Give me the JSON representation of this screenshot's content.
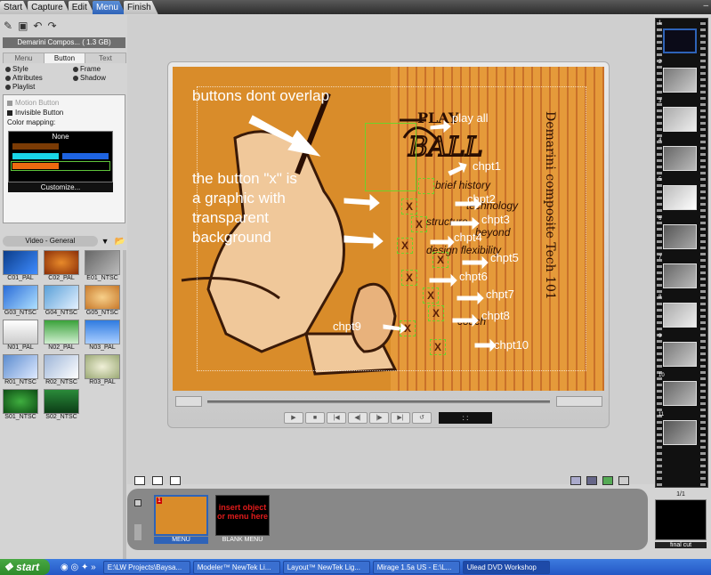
{
  "top_tabs": [
    {
      "label": "Start"
    },
    {
      "label": "Capture"
    },
    {
      "label": "Edit"
    },
    {
      "label": "Menu",
      "active": true
    },
    {
      "label": "Finish"
    }
  ],
  "window_close": "–",
  "project": {
    "name": "Demarini Compos... ( 1.3 GB)"
  },
  "sub_tabs": [
    {
      "label": "Menu"
    },
    {
      "label": "Button",
      "active": true
    },
    {
      "label": "Text"
    }
  ],
  "options": {
    "style": "Style",
    "frame": "Frame",
    "attributes": "Attributes",
    "shadow": "Shadow",
    "playlist": "Playlist"
  },
  "button_panel": {
    "motion_button": "Motion Button",
    "invisible_button": "Invisible Button",
    "color_mapping": "Color mapping:",
    "none": "None",
    "customize": "Customize..."
  },
  "library": {
    "selected": "Video - General",
    "items": [
      "C01_PAL",
      "C02_PAL",
      "E01_NTSC",
      "G03_NTSC",
      "G04_NTSC",
      "G05_NTSC",
      "N01_PAL",
      "N02_PAL",
      "N03_PAL",
      "R01_NTSC",
      "R02_NTSC",
      "R03_PAL",
      "S01_NTSC",
      "S02_NTSC"
    ]
  },
  "menu_preview": {
    "notes": {
      "overlap": "buttons dont overlap",
      "graphic": "the button \"x\" is\na graphic with\ntransparent\nbackground"
    },
    "play_all": "play all",
    "chapters": [
      "chpt1",
      "chpt2",
      "chpt3",
      "chpt4",
      "chpt5",
      "chpt6",
      "chpt7",
      "chpt8",
      "chpt9",
      "chpt10"
    ],
    "x_glyph": "X"
  },
  "transport": {
    "timecode": ": :"
  },
  "filmstrip": {
    "frames": [
      "1",
      "2",
      "3",
      "4",
      "5",
      "6",
      "7",
      "8",
      "9",
      "10",
      "11"
    ]
  },
  "tray": {
    "menu_label": "MENU",
    "blank_label": "BLANK MENU",
    "insert_text": "insert object or menu here"
  },
  "final_cut": {
    "count": "1/1",
    "label": "final cut"
  },
  "taskbar": {
    "start": "start",
    "items": [
      "E:\\LW Projects\\Baysa...",
      "Modeler™ NewTek Li...",
      "Layout™ NewTek Lig...",
      "Mirage 1.5a US - E:\\L...",
      "Ulead DVD Workshop"
    ]
  },
  "colors": {
    "accent": "#2e63b8",
    "menu_bg": "#d98c2a",
    "button_outline": "#6dd22b",
    "swatch_brown": "#7a3b05",
    "swatch_cyan": "#19d6e8",
    "swatch_blue": "#1e63e0",
    "swatch_orange": "#ee6a10"
  }
}
